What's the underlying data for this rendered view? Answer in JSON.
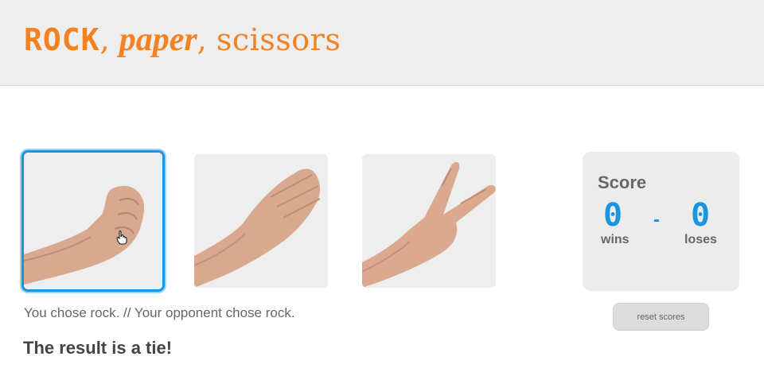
{
  "header": {
    "title_rock": "ROCK",
    "title_comma1": ", ",
    "title_paper": "paper",
    "title_comma2": ", ",
    "title_scissors": "scissors"
  },
  "choices": [
    {
      "id": "rock",
      "selected": true
    },
    {
      "id": "paper",
      "selected": false
    },
    {
      "id": "scissors",
      "selected": false
    }
  ],
  "status": {
    "message": "You chose rock. // Your opponent chose rock.",
    "result": "The result is a tie!"
  },
  "score": {
    "title": "Score",
    "wins": "0",
    "separator": "-",
    "loses": "0",
    "wins_label": "wins",
    "loses_label": "loses"
  },
  "reset_label": "reset scores",
  "colors": {
    "accent_orange": "#f58220",
    "accent_blue": "#1a96e0",
    "header_bg": "#eeeeee",
    "card_bg": "#efeeee"
  },
  "icons": {
    "cursor": "hand-pointer-icon"
  }
}
